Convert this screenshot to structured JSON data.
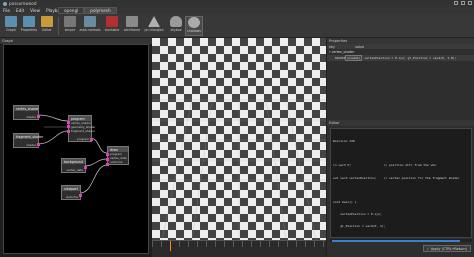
{
  "window": {
    "title": "possumwood"
  },
  "menu": [
    "File",
    "Edit",
    "View",
    "Playback"
  ],
  "top_tabs": [
    {
      "label": "opengl",
      "active": false
    },
    {
      "label": "polymesh",
      "active": true
    }
  ],
  "toolbar": {
    "left": [
      {
        "label": "Graph",
        "icon": "graph-icon",
        "color": "#5a8fb0"
      },
      {
        "label": "Properties",
        "icon": "properties-icon",
        "color": "#5a8fb0"
      },
      {
        "label": "Editor",
        "icon": "editor-icon",
        "color": "#c89a3a"
      }
    ],
    "right": [
      {
        "label": "simple",
        "icon": "simple-icon",
        "color": "#777"
      },
      {
        "label": "auto normals",
        "icon": "auto-normals-icon",
        "color": "#6a8aa0"
      },
      {
        "label": "turntable",
        "icon": "turntable-icon",
        "color": "#b03030"
      },
      {
        "label": "wireframe",
        "icon": "wireframe-icon",
        "color": "#8a8a8a"
      },
      {
        "label": "pn triangles",
        "icon": "pn-triangles-icon",
        "color": "#b0b0b0"
      },
      {
        "label": "skybox",
        "icon": "skybox-icon",
        "color": "#9a9a9a"
      },
      {
        "label": "shadows",
        "icon": "shadows-icon",
        "color": "#aaaaaa"
      }
    ]
  },
  "graph": {
    "header": "Graph",
    "nodes": [
      {
        "title": "vertex_shader",
        "rows": [
          "",
          "shader"
        ]
      },
      {
        "title": "fragment_shader",
        "rows": [
          "",
          "shader"
        ]
      },
      {
        "title": "program",
        "rows": [
          "vertex_shader",
          "geometry_shader",
          "fragment_shader",
          "",
          "program"
        ]
      },
      {
        "title": "background",
        "rows": [
          "",
          "vertex_data"
        ]
      },
      {
        "title": "draw",
        "rows": [
          "program",
          "vertex_data",
          "uniforms"
        ]
      },
      {
        "title": "viewport",
        "rows": [
          "",
          "uniforms"
        ]
      }
    ]
  },
  "properties": {
    "header": "Properties",
    "col_key": "key",
    "col_value": "value",
    "section": "vertex_shader",
    "row_key": "source",
    "row_pill": "invalid()",
    "row_value": "vertexPosition = P.xyz;   gl_Position = vec4(P, 1.0);"
  },
  "editor": {
    "header": "Editor",
    "lines": [
      {
        "text": "#version 130",
        "comment": false
      },
      {
        "text": "",
        "comment": false
      },
      {
        "text": "in vec3 P;                  // position attr from the vbo",
        "comment": false
      },
      {
        "text": "out vec3 vertexPosition;    // vertex position for the fragment shader",
        "comment": false
      },
      {
        "text": "",
        "comment": false
      },
      {
        "text": "void main() {",
        "comment": false
      },
      {
        "text": "    vertexPosition = P.xyz;",
        "comment": false
      },
      {
        "text": "    gl_Position = vec4(P, 1);",
        "comment": false
      },
      {
        "text": "}",
        "comment": false
      }
    ],
    "apply_label": "Apply (CTRL+Return)",
    "apply_checkbox": "✓"
  },
  "colors": {
    "port": "#e040c0",
    "wire": "#cccccc",
    "accent": "#3a7fd0"
  }
}
